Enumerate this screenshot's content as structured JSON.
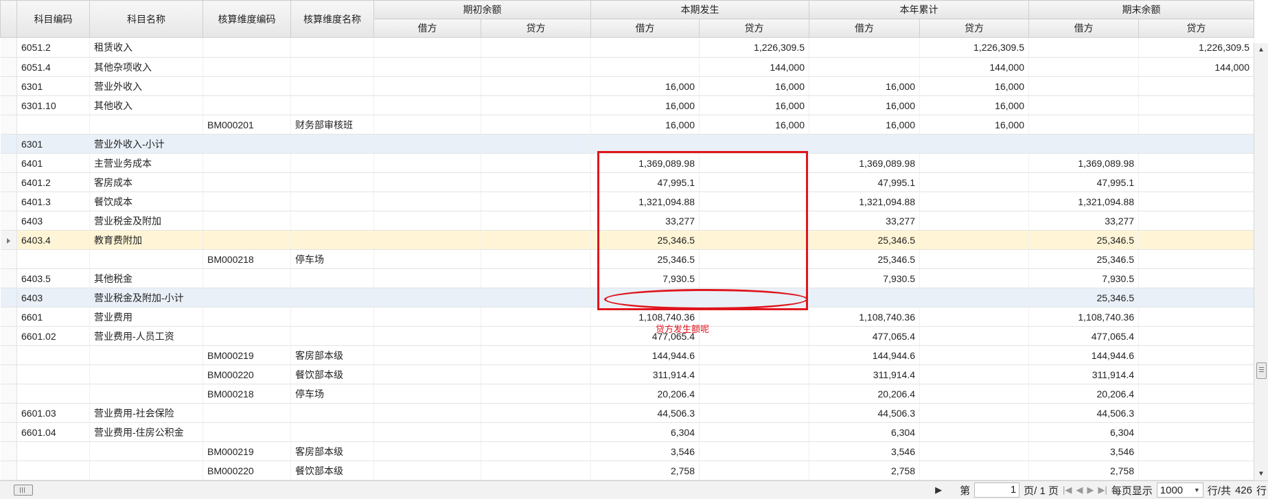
{
  "header": {
    "code": "科目编码",
    "name": "科目名称",
    "dim_code": "核算维度编码",
    "dim_name": "核算维度名称",
    "groups": [
      "期初余额",
      "本期发生",
      "本年累计",
      "期末余额"
    ],
    "debit": "借方",
    "credit": "贷方"
  },
  "rows": [
    {
      "code": "6051.2",
      "name": "租赁收入",
      "dim_code": "",
      "dim_name": "",
      "v": [
        "",
        "",
        "",
        "1,226,309.5",
        "",
        "1,226,309.5",
        "",
        "1,226,309.5"
      ],
      "style": ""
    },
    {
      "code": "6051.4",
      "name": "其他杂项收入",
      "dim_code": "",
      "dim_name": "",
      "v": [
        "",
        "",
        "",
        "144,000",
        "",
        "144,000",
        "",
        "144,000"
      ],
      "style": ""
    },
    {
      "code": "6301",
      "name": "营业外收入",
      "dim_code": "",
      "dim_name": "",
      "v": [
        "",
        "",
        "16,000",
        "16,000",
        "16,000",
        "16,000",
        "",
        ""
      ],
      "style": ""
    },
    {
      "code": "6301.10",
      "name": "其他收入",
      "dim_code": "",
      "dim_name": "",
      "v": [
        "",
        "",
        "16,000",
        "16,000",
        "16,000",
        "16,000",
        "",
        ""
      ],
      "style": ""
    },
    {
      "code": "",
      "name": "",
      "dim_code": "BM000201",
      "dim_name": "财务部审核班",
      "v": [
        "",
        "",
        "16,000",
        "16,000",
        "16,000",
        "16,000",
        "",
        ""
      ],
      "style": ""
    },
    {
      "code": "6301",
      "name": "营业外收入-小计",
      "dim_code": "",
      "dim_name": "",
      "v": [
        "",
        "",
        "",
        "",
        "",
        "",
        "",
        ""
      ],
      "style": "sub"
    },
    {
      "code": "6401",
      "name": "主营业务成本",
      "dim_code": "",
      "dim_name": "",
      "v": [
        "",
        "",
        "1,369,089.98",
        "",
        "1,369,089.98",
        "",
        "1,369,089.98",
        ""
      ],
      "style": ""
    },
    {
      "code": "6401.2",
      "name": "客房成本",
      "dim_code": "",
      "dim_name": "",
      "v": [
        "",
        "",
        "47,995.1",
        "",
        "47,995.1",
        "",
        "47,995.1",
        ""
      ],
      "style": ""
    },
    {
      "code": "6401.3",
      "name": "餐饮成本",
      "dim_code": "",
      "dim_name": "",
      "v": [
        "",
        "",
        "1,321,094.88",
        "",
        "1,321,094.88",
        "",
        "1,321,094.88",
        ""
      ],
      "style": ""
    },
    {
      "code": "6403",
      "name": "营业税金及附加",
      "dim_code": "",
      "dim_name": "",
      "v": [
        "",
        "",
        "33,277",
        "",
        "33,277",
        "",
        "33,277",
        ""
      ],
      "style": ""
    },
    {
      "code": "6403.4",
      "name": "教育费附加",
      "dim_code": "",
      "dim_name": "",
      "v": [
        "",
        "",
        "25,346.5",
        "",
        "25,346.5",
        "",
        "25,346.5",
        ""
      ],
      "style": "sel"
    },
    {
      "code": "",
      "name": "",
      "dim_code": "BM000218",
      "dim_name": "停车场",
      "v": [
        "",
        "",
        "25,346.5",
        "",
        "25,346.5",
        "",
        "25,346.5",
        ""
      ],
      "style": ""
    },
    {
      "code": "6403.5",
      "name": "其他税金",
      "dim_code": "",
      "dim_name": "",
      "v": [
        "",
        "",
        "7,930.5",
        "",
        "7,930.5",
        "",
        "7,930.5",
        ""
      ],
      "style": ""
    },
    {
      "code": "6403",
      "name": "营业税金及附加-小计",
      "dim_code": "",
      "dim_name": "",
      "v": [
        "",
        "",
        "",
        "",
        "",
        "",
        "25,346.5",
        ""
      ],
      "style": "sub"
    },
    {
      "code": "6601",
      "name": "营业费用",
      "dim_code": "",
      "dim_name": "",
      "v": [
        "",
        "",
        "1,108,740.36",
        "",
        "1,108,740.36",
        "",
        "1,108,740.36",
        ""
      ],
      "style": ""
    },
    {
      "code": "6601.02",
      "name": "营业费用-人员工资",
      "dim_code": "",
      "dim_name": "",
      "v": [
        "",
        "",
        "477,065.4",
        "",
        "477,065.4",
        "",
        "477,065.4",
        ""
      ],
      "style": ""
    },
    {
      "code": "",
      "name": "",
      "dim_code": "BM000219",
      "dim_name": "客房部本级",
      "v": [
        "",
        "",
        "144,944.6",
        "",
        "144,944.6",
        "",
        "144,944.6",
        ""
      ],
      "style": ""
    },
    {
      "code": "",
      "name": "",
      "dim_code": "BM000220",
      "dim_name": "餐饮部本级",
      "v": [
        "",
        "",
        "311,914.4",
        "",
        "311,914.4",
        "",
        "311,914.4",
        ""
      ],
      "style": ""
    },
    {
      "code": "",
      "name": "",
      "dim_code": "BM000218",
      "dim_name": "停车场",
      "v": [
        "",
        "",
        "20,206.4",
        "",
        "20,206.4",
        "",
        "20,206.4",
        ""
      ],
      "style": ""
    },
    {
      "code": "6601.03",
      "name": "营业费用-社会保险",
      "dim_code": "",
      "dim_name": "",
      "v": [
        "",
        "",
        "44,506.3",
        "",
        "44,506.3",
        "",
        "44,506.3",
        ""
      ],
      "style": ""
    },
    {
      "code": "6601.04",
      "name": "营业费用-住房公积金",
      "dim_code": "",
      "dim_name": "",
      "v": [
        "",
        "",
        "6,304",
        "",
        "6,304",
        "",
        "6,304",
        ""
      ],
      "style": ""
    },
    {
      "code": "",
      "name": "",
      "dim_code": "BM000219",
      "dim_name": "客房部本级",
      "v": [
        "",
        "",
        "3,546",
        "",
        "3,546",
        "",
        "3,546",
        ""
      ],
      "style": ""
    },
    {
      "code": "",
      "name": "",
      "dim_code": "BM000220",
      "dim_name": "餐饮部本级",
      "v": [
        "",
        "",
        "2,758",
        "",
        "2,758",
        "",
        "2,758",
        ""
      ],
      "style": ""
    }
  ],
  "annotation": {
    "note": "贷方发生额呢",
    "color": "#e0141d"
  },
  "pager": {
    "page_prefix": "第",
    "page_value": "1",
    "page_suffix": "页/ 1 页",
    "per_page_label": "每页显示",
    "per_page_value": "1000",
    "total_prefix": "行/共",
    "total_value": "426",
    "total_suffix": "行"
  },
  "icons": {
    "row_indicator": "arrow-right-icon",
    "first": "first-page-icon",
    "prev": "prev-page-icon",
    "next": "next-page-icon",
    "last": "last-page-icon",
    "dropdown": "chevron-down-icon"
  }
}
